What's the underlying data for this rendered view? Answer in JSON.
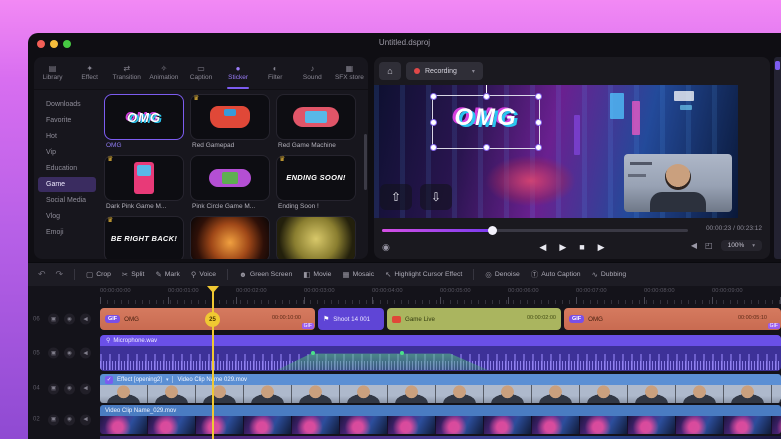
{
  "titlebar": {
    "title": "Untitled.dsproj"
  },
  "colors": {
    "accent_purple": "#7c5cf0",
    "record_red": "#e04848",
    "playhead_yellow": "#f0c832",
    "clip_salmon": "#cf7258",
    "clip_olive": "#aab55f",
    "clip_violet": "#5f45d6",
    "seekbar_magenta": "#c84fe0"
  },
  "icons": {
    "home": "⌂",
    "chevron_down": "▾",
    "snapshot": "◉",
    "prev": "◀",
    "play": "▶",
    "stop": "■",
    "next": "▶",
    "speaker": "◀",
    "fullscreen": "◰",
    "lock": "▣",
    "eye": "◉",
    "mute": "◀",
    "crown": "♛",
    "shoot": "⚑",
    "mic": "⚲",
    "check": "✓",
    "divider": "│",
    "ghost_up": "⇧",
    "ghost_down": "⇩",
    "undo": "↶",
    "redo": "↷"
  },
  "media": {
    "tabs": [
      {
        "icon": "▤",
        "label": "Library"
      },
      {
        "icon": "✦",
        "label": "Effect"
      },
      {
        "icon": "⇄",
        "label": "Transition"
      },
      {
        "icon": "✧",
        "label": "Animation"
      },
      {
        "icon": "▭",
        "label": "Caption"
      },
      {
        "icon": "●",
        "label": "Sticker"
      },
      {
        "icon": "◐",
        "label": "Filter"
      },
      {
        "icon": "♪",
        "label": "Sound"
      },
      {
        "icon": "▦",
        "label": "SFX store"
      }
    ],
    "active_tab": "Sticker",
    "sidebar": {
      "items": [
        "Downloads",
        "Favorite",
        "Hot",
        "Vip",
        "Education",
        "Game",
        "Social Media",
        "Vlog",
        "Emoji"
      ],
      "selected": "Game"
    },
    "stickers": [
      {
        "label": "OMG",
        "art_text": "OMG"
      },
      {
        "label": "Red Gamepad"
      },
      {
        "label": "Red Game Machine"
      },
      {
        "label": "Dark Pink Game M..."
      },
      {
        "label": "Pink Circle Game M..."
      },
      {
        "label": "Ending Soon !",
        "art_text": "ENDING SOON!"
      },
      {
        "label": "Be Right Back!",
        "art_text": "BE RIGHT BACK!"
      }
    ]
  },
  "preview": {
    "recording": "Recording",
    "overlay_text": "OMG",
    "time_current": "00:00:23",
    "time_sep": "/",
    "time_total": "00:23:12",
    "zoom": "100%"
  },
  "toolbar": {
    "items": [
      {
        "icon": "▢",
        "label": "Crop"
      },
      {
        "icon": "✂",
        "label": "Split"
      },
      {
        "icon": "✎",
        "label": "Mark"
      },
      {
        "icon": "⚲",
        "label": "Voice"
      },
      {
        "icon": "☻",
        "label": "Green Screen"
      },
      {
        "icon": "◧",
        "label": "Movie"
      },
      {
        "icon": "▦",
        "label": "Mosaic"
      },
      {
        "icon": "↖",
        "label": "Highlight Cursor Effect"
      },
      {
        "icon": "◎",
        "label": "Denoise"
      },
      {
        "icon": "Ⓣ",
        "label": "Auto Caption"
      },
      {
        "icon": "∿",
        "label": "Dubbing"
      }
    ]
  },
  "timeline": {
    "ruler": [
      "00:00:00:00",
      "00:00:01:00",
      "00:00:02:00",
      "00:00:03:00",
      "00:00:04:00",
      "00:00:05:00",
      "00:00:06:00",
      "00:00:07:00",
      "00:00:08:00",
      "00:00:09:00"
    ],
    "playhead_badge": "25",
    "track1": {
      "num": "06",
      "clip_a": {
        "badge": "GIF",
        "label": "OMG",
        "duration": "00:00:10:00",
        "tag": "GIF"
      },
      "clip_b": {
        "label": "Shoot 14 001"
      },
      "clip_c": {
        "label": "Game Live",
        "duration": "00:00:02:00"
      },
      "clip_d": {
        "badge": "GIF",
        "label": "OMG",
        "duration": "00:00:05:10",
        "tag": "GIF"
      }
    },
    "track2": {
      "num": "05",
      "label": "Microphone.wav"
    },
    "track3": {
      "num": "04",
      "effect_label": "Effect [opening2]",
      "clip_label": "Video Clip Name 029.mov"
    },
    "track4": {
      "num": "02",
      "clip_label": "Video Clip Name_029.mov"
    }
  }
}
